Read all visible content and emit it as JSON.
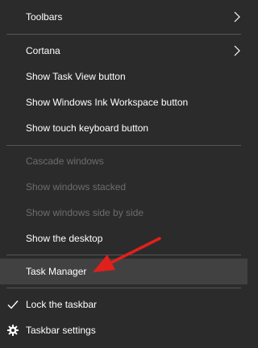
{
  "menu": {
    "items": [
      {
        "label": "Toolbars"
      },
      {
        "label": "Cortana"
      },
      {
        "label": "Show Task View button"
      },
      {
        "label": "Show Windows Ink Workspace button"
      },
      {
        "label": "Show touch keyboard button"
      },
      {
        "label": "Cascade windows"
      },
      {
        "label": "Show windows stacked"
      },
      {
        "label": "Show windows side by side"
      },
      {
        "label": "Show the desktop"
      },
      {
        "label": "Task Manager"
      },
      {
        "label": "Lock the taskbar"
      },
      {
        "label": "Taskbar settings"
      }
    ]
  },
  "colors": {
    "background": "#2b2b2b",
    "text": "#ffffff",
    "disabled_text": "#6d6d6d",
    "highlight": "#414141",
    "separator": "#555555",
    "annotation_arrow": "#e0201c"
  },
  "icons": {
    "submenu": "chevron-right-icon",
    "checked": "checkmark-icon",
    "settings": "gear-icon",
    "annotation": "red-arrow-icon"
  }
}
